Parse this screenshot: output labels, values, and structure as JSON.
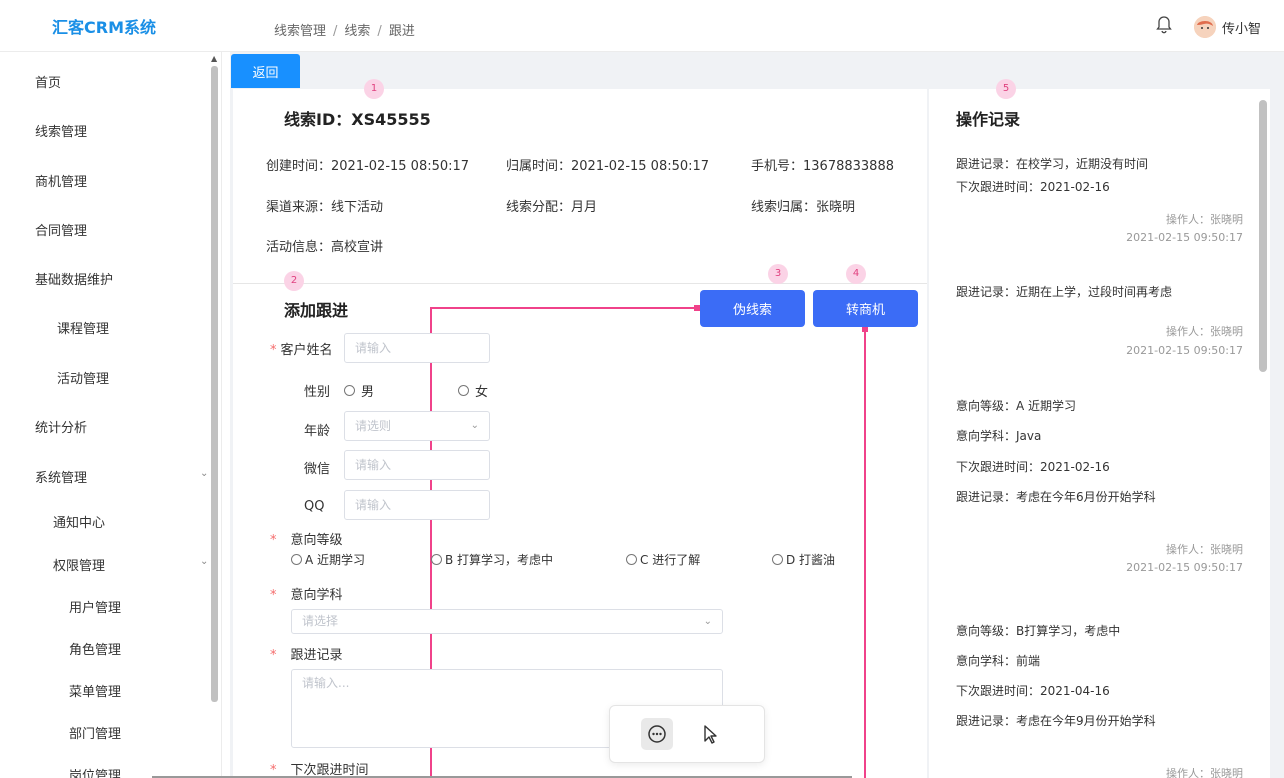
{
  "app": {
    "title": "汇客CRM系统"
  },
  "breadcrumb": [
    "线索管理",
    "线索",
    "跟进"
  ],
  "user": {
    "name": "传小智"
  },
  "sidebar": {
    "items": [
      {
        "label": "首页"
      },
      {
        "label": "线索管理"
      },
      {
        "label": "商机管理"
      },
      {
        "label": "合同管理"
      },
      {
        "label": "基础数据维护"
      },
      {
        "label": "课程管理"
      },
      {
        "label": "活动管理"
      },
      {
        "label": "统计分析"
      },
      {
        "label": "系统管理"
      },
      {
        "label": "通知中心"
      },
      {
        "label": "权限管理"
      },
      {
        "label": "用户管理"
      },
      {
        "label": "角色管理"
      },
      {
        "label": "菜单管理"
      },
      {
        "label": "部门管理"
      },
      {
        "label": "岗位管理"
      }
    ]
  },
  "back_label": "返回",
  "clue": {
    "title": "线索ID：XS45555",
    "fields": [
      "创建时间：2021-02-15 08:50:17",
      "归属时间：2021-02-15 08:50:17",
      "手机号：13678833888",
      "渠道来源：线下活动",
      "线索分配：月月",
      "线索归属：张晓明",
      "活动信息：高校宣讲"
    ]
  },
  "markers": [
    "1",
    "2",
    "3",
    "4",
    "5"
  ],
  "form": {
    "title": "添加跟进",
    "name_label": "客户姓名",
    "input_placeholder": "请输入",
    "gender_label": "性别",
    "gender_options": [
      "男",
      "女"
    ],
    "age_label": "年龄",
    "age_placeholder": "请选则",
    "wechat_label": "微信",
    "qq_label": "QQ",
    "intent_level_label": "意向等级",
    "intent_options": [
      "A 近期学习",
      "B 打算学习，考虑中",
      "C 进行了解",
      "D 打酱油"
    ],
    "intent_subject_label": "意向学科",
    "subject_placeholder": "请选择",
    "record_label": "跟进记录",
    "record_placeholder": "请输入...",
    "next_time_label": "下次跟进时间",
    "required_mark": "*"
  },
  "actions": {
    "fake_label": "伪线索",
    "convert_label": "转商机"
  },
  "ops": {
    "title": "操作记录",
    "records": [
      {
        "lines": [
          "跟进记录：在校学习，近期没有时间",
          "下次跟进时间：2021-02-16"
        ],
        "operator": "操作人：张晓明",
        "time": "2021-02-15 09:50:17"
      },
      {
        "lines": [
          "跟进记录：近期在上学，过段时间再考虑"
        ],
        "operator": "操作人：张晓明",
        "time": "2021-02-15 09:50:17"
      },
      {
        "lines": [
          "意向等级：A 近期学习",
          "意向学科：Java",
          "下次跟进时间：2021-02-16",
          "跟进记录：考虑在今年6月份开始学科"
        ],
        "operator": "操作人：张晓明",
        "time": "2021-02-15 09:50:17"
      },
      {
        "lines": [
          "意向等级：B打算学习，考虑中",
          "意向学科：前端",
          "下次跟进时间：2021-04-16",
          "跟进记录：考虑在今年9月份开始学科"
        ],
        "operator": "操作人：张晓明"
      }
    ]
  },
  "colors": {
    "accent": "#1890ff",
    "button": "#3b6cf6",
    "annotation": "#f0428a"
  }
}
